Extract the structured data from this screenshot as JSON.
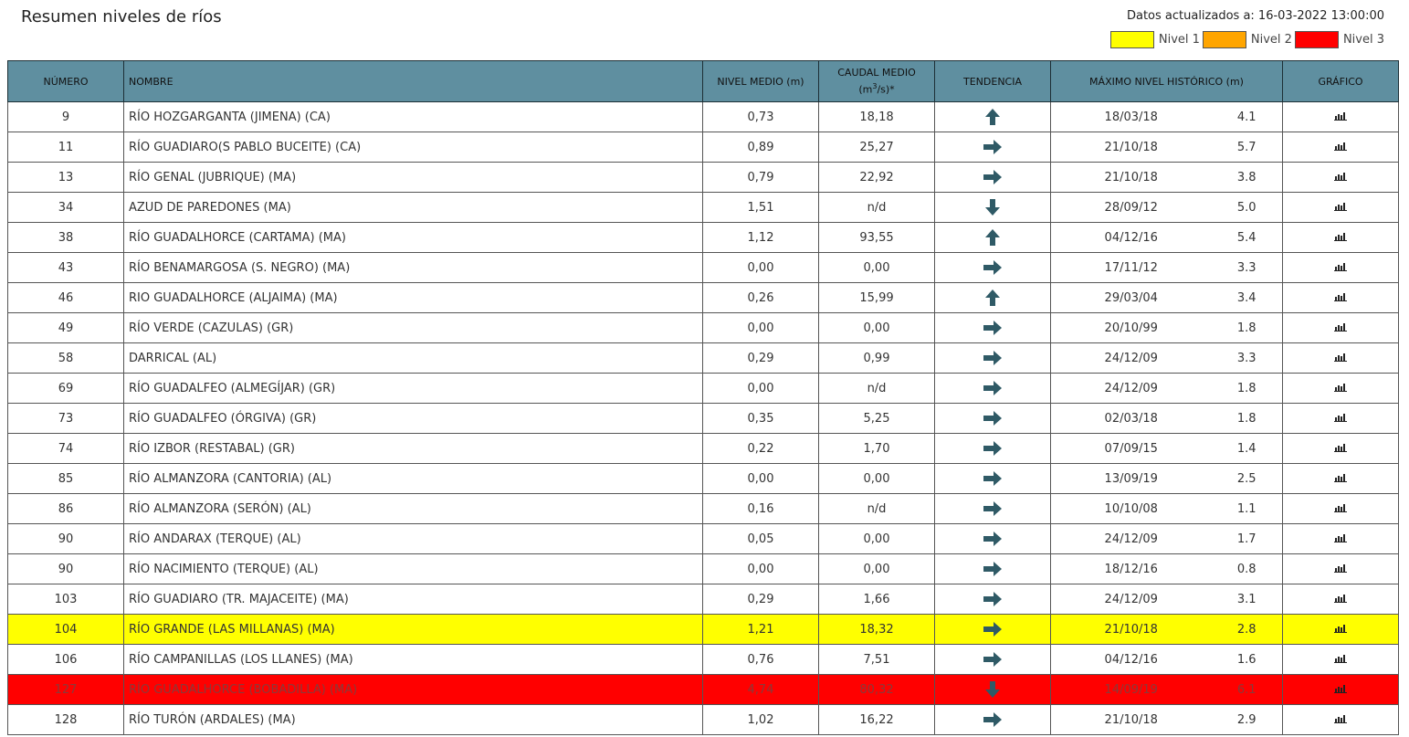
{
  "page": {
    "title": "Resumen niveles de ríos",
    "updated": "Datos actualizados a: 16-03-2022 13:00:00"
  },
  "legend": [
    {
      "label": "Nivel 1",
      "color": "#ffff00"
    },
    {
      "label": "Nivel 2",
      "color": "#ffa500"
    },
    {
      "label": "Nivel 3",
      "color": "#ff0000"
    }
  ],
  "table": {
    "headers": {
      "numero": "NÚMERO",
      "nombre": "NOMBRE",
      "nivel": "NIVEL MEDIO (m)",
      "caudal_line1": "CAUDAL MEDIO",
      "caudal_line2_pre": "(m",
      "caudal_sup": "3",
      "caudal_line2_post": "/s)*",
      "tendencia": "TENDENCIA",
      "maximo": "MÁXIMO NIVEL HISTÓRICO (m)",
      "grafico": "GRÁFICO"
    },
    "rows": [
      {
        "num": "9",
        "name": "RÍO HOZGARGANTA (JIMENA) (CA)",
        "nivel": "0,73",
        "caudal": "18,18",
        "trend": "up",
        "date": "18/03/18",
        "max": "4.1",
        "level": ""
      },
      {
        "num": "11",
        "name": "RÍO GUADIARO(S PABLO BUCEITE) (CA)",
        "nivel": "0,89",
        "caudal": "25,27",
        "trend": "right",
        "date": "21/10/18",
        "max": "5.7",
        "level": ""
      },
      {
        "num": "13",
        "name": "RÍO GENAL (JUBRIQUE) (MA)",
        "nivel": "0,79",
        "caudal": "22,92",
        "trend": "right",
        "date": "21/10/18",
        "max": "3.8",
        "level": ""
      },
      {
        "num": "34",
        "name": "AZUD DE PAREDONES (MA)",
        "nivel": "1,51",
        "caudal": "n/d",
        "trend": "down",
        "date": "28/09/12",
        "max": "5.0",
        "level": ""
      },
      {
        "num": "38",
        "name": "RÍO GUADALHORCE (CARTAMA) (MA)",
        "nivel": "1,12",
        "caudal": "93,55",
        "trend": "up",
        "date": "04/12/16",
        "max": "5.4",
        "level": ""
      },
      {
        "num": "43",
        "name": "RÍO BENAMARGOSA (S. NEGRO) (MA)",
        "nivel": "0,00",
        "caudal": "0,00",
        "trend": "right",
        "date": "17/11/12",
        "max": "3.3",
        "level": ""
      },
      {
        "num": "46",
        "name": "RIO GUADALHORCE (ALJAIMA) (MA)",
        "nivel": "0,26",
        "caudal": "15,99",
        "trend": "up",
        "date": "29/03/04",
        "max": "3.4",
        "level": ""
      },
      {
        "num": "49",
        "name": "RÍO VERDE (CAZULAS) (GR)",
        "nivel": "0,00",
        "caudal": "0,00",
        "trend": "right",
        "date": "20/10/99",
        "max": "1.8",
        "level": ""
      },
      {
        "num": "58",
        "name": "DARRICAL (AL)",
        "nivel": "0,29",
        "caudal": "0,99",
        "trend": "right",
        "date": "24/12/09",
        "max": "3.3",
        "level": ""
      },
      {
        "num": "69",
        "name": "RÍO GUADALFEO (ALMEGÍJAR) (GR)",
        "nivel": "0,00",
        "caudal": "n/d",
        "trend": "right",
        "date": "24/12/09",
        "max": "1.8",
        "level": ""
      },
      {
        "num": "73",
        "name": "RÍO GUADALFEO (ÓRGIVA) (GR)",
        "nivel": "0,35",
        "caudal": "5,25",
        "trend": "right",
        "date": "02/03/18",
        "max": "1.8",
        "level": ""
      },
      {
        "num": "74",
        "name": "RÍO IZBOR (RESTABAL) (GR)",
        "nivel": "0,22",
        "caudal": "1,70",
        "trend": "right",
        "date": "07/09/15",
        "max": "1.4",
        "level": ""
      },
      {
        "num": "85",
        "name": "RÍO ALMANZORA (CANTORIA) (AL)",
        "nivel": "0,00",
        "caudal": "0,00",
        "trend": "right",
        "date": "13/09/19",
        "max": "2.5",
        "level": ""
      },
      {
        "num": "86",
        "name": "RÍO ALMANZORA (SERÓN) (AL)",
        "nivel": "0,16",
        "caudal": "n/d",
        "trend": "right",
        "date": "10/10/08",
        "max": "1.1",
        "level": ""
      },
      {
        "num": "90",
        "name": "RÍO ANDARAX (TERQUE) (AL)",
        "nivel": "0,05",
        "caudal": "0,00",
        "trend": "right",
        "date": "24/12/09",
        "max": "1.7",
        "level": ""
      },
      {
        "num": "90",
        "name": "RÍO NACIMIENTO (TERQUE) (AL)",
        "nivel": "0,00",
        "caudal": "0,00",
        "trend": "right",
        "date": "18/12/16",
        "max": "0.8",
        "level": ""
      },
      {
        "num": "103",
        "name": "RÍO GUADIARO (TR. MAJACEITE) (MA)",
        "nivel": "0,29",
        "caudal": "1,66",
        "trend": "right",
        "date": "24/12/09",
        "max": "3.1",
        "level": ""
      },
      {
        "num": "104",
        "name": "RÍO GRANDE (LAS MILLANAS) (MA)",
        "nivel": "1,21",
        "caudal": "18,32",
        "trend": "right",
        "date": "21/10/18",
        "max": "2.8",
        "level": "1"
      },
      {
        "num": "106",
        "name": "RÍO CAMPANILLAS (LOS LLANES) (MA)",
        "nivel": "0,76",
        "caudal": "7,51",
        "trend": "right",
        "date": "04/12/16",
        "max": "1.6",
        "level": ""
      },
      {
        "num": "127",
        "name": "RÍO GUADALHORCE (BOBADILLA) (MA)",
        "nivel": "4,74",
        "caudal": "80,32",
        "trend": "down",
        "date": "14/09/19",
        "max": "6.1",
        "level": "3"
      },
      {
        "num": "128",
        "name": "RÍO TURÓN (ARDALES) (MA)",
        "nivel": "1,02",
        "caudal": "16,22",
        "trend": "right",
        "date": "21/10/18",
        "max": "2.9",
        "level": ""
      }
    ]
  }
}
